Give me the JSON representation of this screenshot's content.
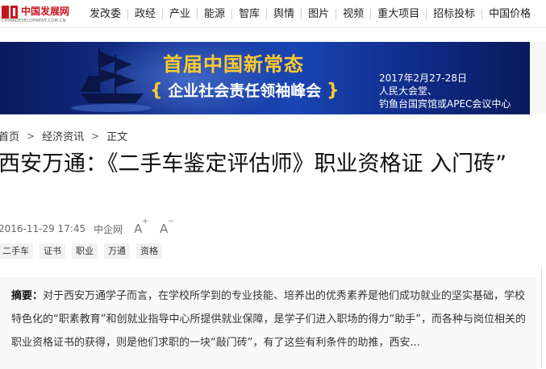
{
  "logo": {
    "name_cn": "中国发展网",
    "domain": "CHINADEVELOPMENT.COM.CN"
  },
  "nav": [
    "发改委",
    "政经",
    "产业",
    "能源",
    "智库",
    "舆情",
    "图片",
    "视频",
    "重大项目",
    "招标投标",
    "中国价格"
  ],
  "banner": {
    "headline": "首届中国新常态",
    "subheadline": "企业社会责任领袖峰会",
    "date": "2017年2月27-28日",
    "venue_1": "人民大会堂、",
    "venue_2": "钓鱼台国宾馆或APEC会议中心"
  },
  "breadcrumb": [
    "首页",
    "经济资讯",
    "正文"
  ],
  "article": {
    "title": "西安万通：《二手车鉴定评估师》职业资格证 入门砖”",
    "datetime": "2016-11-29 17:45",
    "source": "中企网",
    "font_up": "A",
    "font_down": "A",
    "tags": [
      "二手车",
      "证书",
      "职业",
      "万通",
      "资格"
    ],
    "summary_label": "摘要：",
    "summary": "对于西安万通学子而言，在学校所学到的专业技能、培养出的优秀素养是他们成功就业的坚实基础，学校特色化的“职素教育”和创就业指导中心所提供就业保障，是学子们进入职场的得力“助手”，而各种与岗位相关的职业资格证书的获得，则是他们求职的一块“敲门砖”，有了这些有利条件的助推，西安..."
  }
}
